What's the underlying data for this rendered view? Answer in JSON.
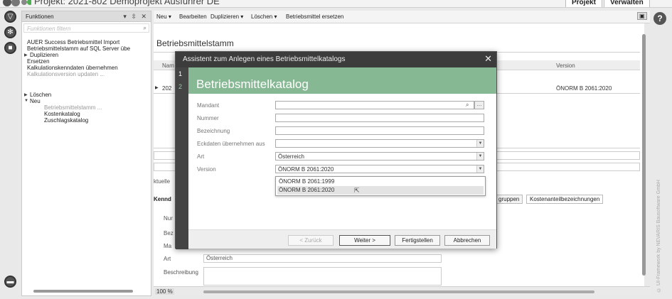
{
  "window": {
    "title": "Projekt: 2021-802 Demoprojekt Ausführer DE",
    "tabs": [
      "Projekt",
      "Verwalten"
    ]
  },
  "left_panel": {
    "title": "Funktionen",
    "controls": "▾ ⇳ ✕",
    "filter_placeholder": "Funktionen filtern",
    "items": [
      {
        "label": "AUER Success Betriebsmittel Import",
        "dim": false
      },
      {
        "label": "Betriebsmittelstamm auf SQL Server übe",
        "dim": false
      },
      {
        "label": "Duplizieren",
        "dim": false
      },
      {
        "label": "Ersetzen",
        "dim": false
      },
      {
        "label": "Kalkulationskenndaten übernehmen",
        "dim": false
      },
      {
        "label": "Kalkulationsversion updaten ...",
        "dim": true
      },
      {
        "label": "Löschen",
        "dim": false
      },
      {
        "label": "Neu",
        "dim": false
      },
      {
        "label": "Betriebsmittelstamm ...",
        "dim": true
      },
      {
        "label": "Kostenkatalog",
        "dim": false
      },
      {
        "label": "Zuschlagskatalog",
        "dim": false
      }
    ]
  },
  "toolbar": {
    "items": [
      "Neu ▾",
      "Bearbeiten",
      "Duplizieren ▾",
      "Löschen ▾",
      "Betriebsmittel ersetzen"
    ]
  },
  "main": {
    "heading": "Betriebsmittelstamm",
    "table_header_left": "Nam",
    "table_header_version": "Version",
    "row_left": "202",
    "row_version": "ÖNORM B 2061:2020",
    "aktuelle_label": "ktuelle",
    "kenn_label": "Kennd",
    "tabs": [
      "gruppen",
      "Kostenanteilbezeichnungen"
    ],
    "form_labels": [
      "Nur",
      "Bez",
      "Ma",
      "Art",
      "Beschreibung"
    ],
    "art_value": "Österreich"
  },
  "status": {
    "zoom": "100 %"
  },
  "right_strip": {
    "copyright": "© UI-Framework by NEVARIS Bausoftware GmbH"
  },
  "dialog": {
    "title": "Assistent zum Anlegen eines Betriebsmittelkatalogs",
    "close": "✕",
    "step1": "1",
    "step2": "2",
    "banner": "Betriebsmittelkatalog",
    "fields": [
      {
        "label": "Mandant",
        "value": ""
      },
      {
        "label": "Nummer",
        "value": ""
      },
      {
        "label": "Bezeichnung",
        "value": ""
      },
      {
        "label": "Eckdaten übernehmen aus",
        "value": ""
      },
      {
        "label": "Art",
        "value": "Österreich"
      },
      {
        "label": "Version",
        "value": "ÖNORM B 2061:2020"
      }
    ],
    "version_options": [
      "ÖNORM B 2061:1999",
      "ÖNORM B 2061:2020"
    ],
    "selected_option": 1,
    "buttons": {
      "back": "< Zurück",
      "next": "Weiter >",
      "finish": "Fertigstellen",
      "cancel": "Abbrechen"
    }
  },
  "icons": {
    "search": "search-icon",
    "dropdown": "chevron-down-icon",
    "help": "help-icon",
    "close": "close-icon"
  }
}
